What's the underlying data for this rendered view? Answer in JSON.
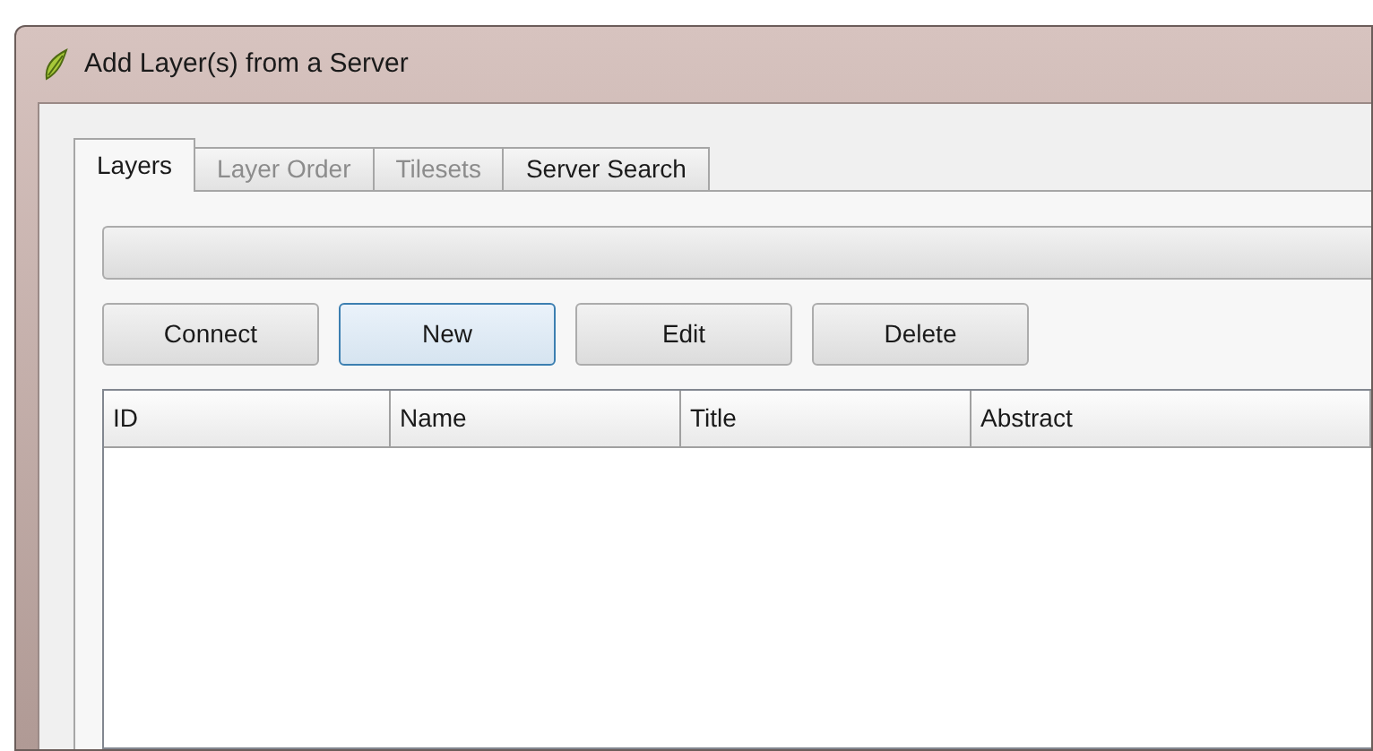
{
  "window": {
    "title": "Add Layer(s) from a Server"
  },
  "tabs": [
    {
      "label": "Layers",
      "selected": true,
      "disabled": false
    },
    {
      "label": "Layer Order",
      "selected": false,
      "disabled": true
    },
    {
      "label": "Tilesets",
      "selected": false,
      "disabled": true
    },
    {
      "label": "Server Search",
      "selected": false,
      "disabled": false
    }
  ],
  "buttons": [
    {
      "label": "Connect",
      "focused": false
    },
    {
      "label": "New",
      "focused": true
    },
    {
      "label": "Edit",
      "focused": false
    },
    {
      "label": "Delete",
      "focused": false
    }
  ],
  "table": {
    "columns": [
      "ID",
      "Name",
      "Title",
      "Abstract"
    ]
  }
}
